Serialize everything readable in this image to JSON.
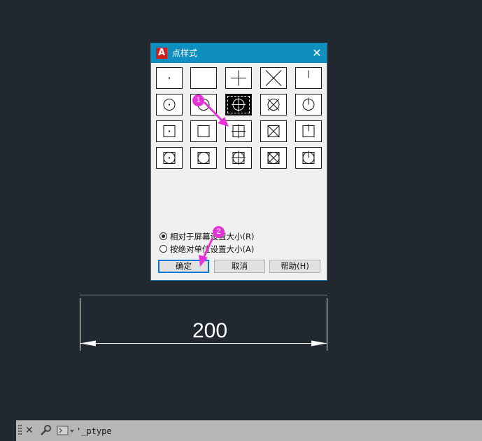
{
  "dialog": {
    "title": "点样式",
    "app_icon_letter": "A",
    "close_glyph": "✕",
    "point_styles": [
      "dot",
      "none",
      "plus",
      "cross",
      "tick",
      "circle-dot",
      "circle",
      "circle-plus",
      "circle-cross",
      "circle-tick",
      "square-dot",
      "square",
      "square-plus",
      "square-cross",
      "square-tick",
      "square-circle-dot",
      "square-circle",
      "square-circle-plus",
      "square-circle-cross",
      "square-circle-tick"
    ],
    "selected_style_index": 7,
    "radio_options": [
      {
        "label": "相对于屏幕设置大小(R)",
        "checked": true
      },
      {
        "label": "按绝对单位设置大小(A)",
        "checked": false
      }
    ],
    "buttons": {
      "ok": "确定",
      "cancel": "取消",
      "help": "帮助(H)"
    }
  },
  "annotations": [
    {
      "label": "1"
    },
    {
      "label": "2"
    }
  ],
  "drawing": {
    "dimension_value": "200"
  },
  "command_line": {
    "text": "'_ptype",
    "close_icon": "close-icon",
    "wrench_icon": "wrench-icon",
    "prompt_icon": "command-prompt-icon"
  },
  "colors": {
    "background": "#212830",
    "title_bar": "#0e8fc0",
    "marker": "#e633d8",
    "command_bar": "#b6b6b6"
  }
}
